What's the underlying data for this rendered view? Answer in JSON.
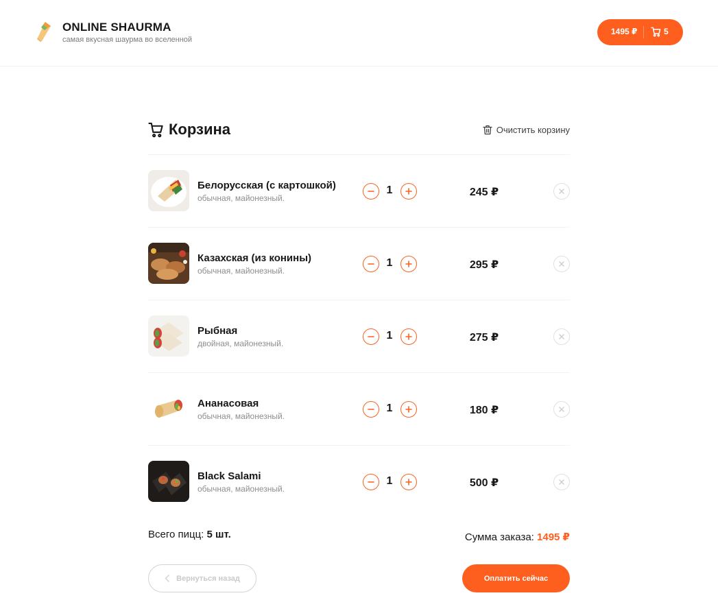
{
  "header": {
    "title": "ONLINE SHAURMA",
    "subtitle": "самая вкусная шаурма во вселенной",
    "logo_icon": "shaurma-logo",
    "cart_button": {
      "price": "1495 ₽",
      "count": "5",
      "icon": "cart-icon"
    }
  },
  "cart": {
    "title": "Корзина",
    "clear_label": "Очистить корзину",
    "items": [
      {
        "name": "Белорусская (с картошкой)",
        "desc": "обычная, майонезный.",
        "qty": "1",
        "price": "245 ₽"
      },
      {
        "name": "Казахская (из конины)",
        "desc": "обычная, майонезный.",
        "qty": "1",
        "price": "295 ₽"
      },
      {
        "name": "Рыбная",
        "desc": "двойная, майонезный.",
        "qty": "1",
        "price": "275 ₽"
      },
      {
        "name": "Ананасовая",
        "desc": "обычная, майонезный.",
        "qty": "1",
        "price": "180 ₽"
      },
      {
        "name": "Black Salami",
        "desc": "обычная, майонезный.",
        "qty": "1",
        "price": "500 ₽"
      }
    ],
    "total_count_label": "Всего пицц:",
    "total_count_value": "5 шт.",
    "total_sum_label": "Сумма заказа:",
    "total_sum_value": "1495 ₽",
    "back_label": "Вернуться назад",
    "pay_label": "Оплатить сейчас"
  },
  "colors": {
    "accent": "#fe5f1e",
    "text": "#181818",
    "muted": "#8d8d8d"
  }
}
